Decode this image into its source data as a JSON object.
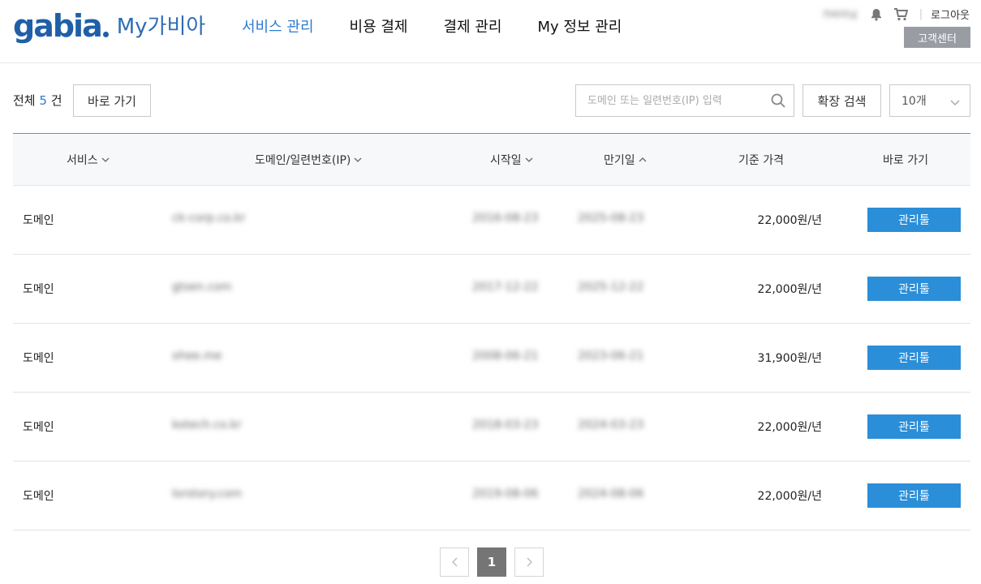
{
  "header": {
    "logo_word": "gabia",
    "logo_sub": "My가비아",
    "nav": [
      "서비스 관리",
      "비용 결제",
      "결제 관리",
      "My 정보 관리"
    ],
    "active_nav": 0,
    "user_name": "가비아님",
    "logout": "로그아웃",
    "customer_center": "고객센터"
  },
  "toolbar": {
    "total_prefix": "전체",
    "total_count": "5",
    "total_suffix": "건",
    "go_button": "바로 가기",
    "search_placeholder": "도메인 또는 일련번호(IP) 입력",
    "advanced_search": "확장 검색",
    "page_size": "10개"
  },
  "table": {
    "columns": [
      "서비스",
      "도메인/일련번호(IP)",
      "시작일",
      "만기일",
      "기준 가격",
      "바로 가기"
    ],
    "rows": [
      {
        "service": "도메인",
        "domain": "ck-corp.co.kr",
        "start": "2016-08-23",
        "end": "2025-08-23",
        "price": "22,000원/년",
        "action": "관리툴"
      },
      {
        "service": "도메인",
        "domain": "gtsen.com",
        "start": "2017-12-22",
        "end": "2025-12-22",
        "price": "22,000원/년",
        "action": "관리툴"
      },
      {
        "service": "도메인",
        "domain": "ohee.me",
        "start": "2008-06-21",
        "end": "2023-06-21",
        "price": "31,900원/년",
        "action": "관리툴"
      },
      {
        "service": "도메인",
        "domain": "kotech.co.kr",
        "start": "2018-03-23",
        "end": "2024-03-23",
        "price": "22,000원/년",
        "action": "관리툴"
      },
      {
        "service": "도메인",
        "domain": "lorstory.com",
        "start": "2019-08-06",
        "end": "2024-08-06",
        "price": "22,000원/년",
        "action": "관리툴"
      }
    ]
  },
  "pagination": {
    "current": "1"
  },
  "colors": {
    "brand": "#1f5fa8",
    "active_nav": "#2f7bd0",
    "action_button": "#2b8ed8"
  }
}
